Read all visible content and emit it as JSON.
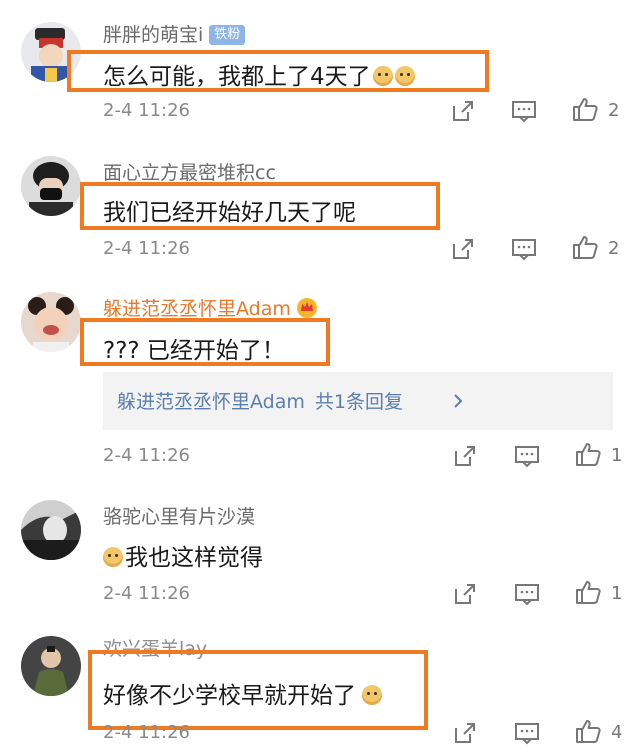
{
  "colors": {
    "highlight": "#f07a22",
    "link": "#5b7fae",
    "vip_name": "#e8782b",
    "muted": "#8a8a8a"
  },
  "comments": [
    {
      "username": "胖胖的萌宝i",
      "badge": "铁粉",
      "text": "怎么可能，我都上了4天了",
      "emoji_count": 2,
      "time": "2-4 11:26",
      "likes": "2"
    },
    {
      "username": "面心立方最密堆积cc",
      "text": "我们已经开始好几天了呢",
      "time": "2-4 11:26",
      "likes": "2"
    },
    {
      "username": "躲进范丞丞怀里Adam",
      "text": "??? 已经开始了！",
      "time": "2-4 11:26",
      "likes": "1",
      "reply": {
        "name": "躲进范丞丞怀里Adam",
        "count_text": "共1条回复"
      }
    },
    {
      "username": "骆驼心里有片沙漠",
      "text": "我也这样觉得",
      "time": "2-4 11:26",
      "likes": "1"
    },
    {
      "username": "欢兴蛋羊lay",
      "text": "好像不少学校早就开始了",
      "time": "2-4 11:26",
      "likes": "4"
    }
  ]
}
